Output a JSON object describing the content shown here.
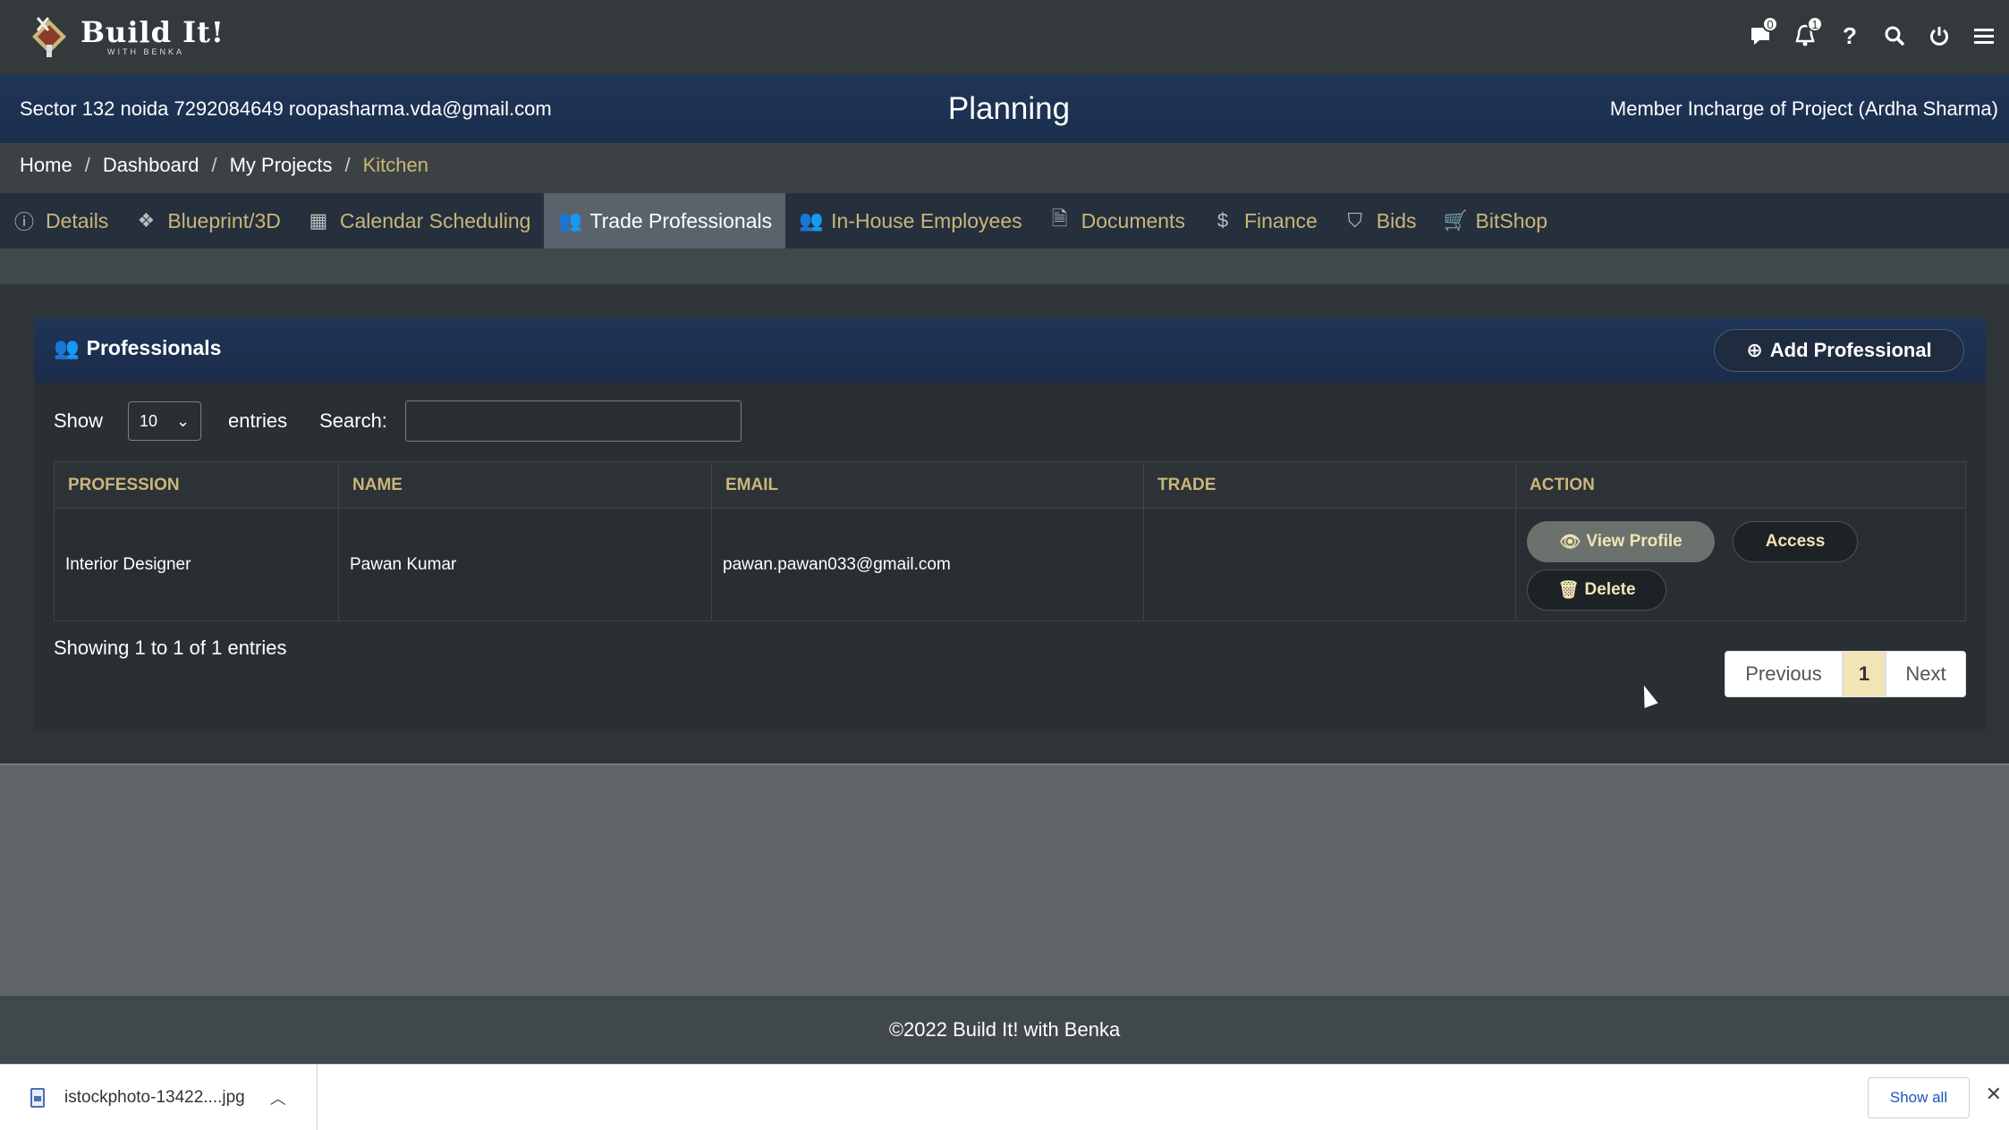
{
  "app": {
    "logo_title": "Build It!",
    "logo_sub": "WITH BENKA"
  },
  "topnav": {
    "messages_count": "0",
    "notifications_count": "1"
  },
  "project": {
    "address_info": "Sector 132 noida 7292084649 roopasharma.vda@gmail.com",
    "stage": "Planning",
    "member": "Member Incharge of Project (Ardha Sharma)"
  },
  "breadcrumb": {
    "items": [
      "Home",
      "Dashboard",
      "My Projects",
      "Kitchen"
    ]
  },
  "tabs": [
    {
      "label": "Details",
      "icon": "info-icon"
    },
    {
      "label": "Blueprint/3D",
      "icon": "cubes-icon"
    },
    {
      "label": "Calendar Scheduling",
      "icon": "calendar-icon"
    },
    {
      "label": "Trade Professionals",
      "icon": "users-icon",
      "active": true
    },
    {
      "label": "In-House Employees",
      "icon": "users-icon"
    },
    {
      "label": "Documents",
      "icon": "document-icon"
    },
    {
      "label": "Finance",
      "icon": "dollar-icon"
    },
    {
      "label": "Bids",
      "icon": "shield-icon"
    },
    {
      "label": "BitShop",
      "icon": "cart-icon"
    }
  ],
  "panel": {
    "title": "Professionals",
    "add_label": "Add Professional",
    "show_label": "Show",
    "entries_value": "10",
    "entries_label": "entries",
    "search_label": "Search:",
    "search_value": ""
  },
  "table": {
    "headers": [
      "PROFESSION",
      "NAME",
      "EMAIL",
      "TRADE",
      "ACTION"
    ],
    "rows": [
      {
        "profession": "Interior Designer",
        "name": "Pawan Kumar",
        "email": "pawan.pawan033@gmail.com",
        "trade": ""
      }
    ],
    "actions": {
      "view_profile": "View Profile",
      "access": "Access",
      "delete": "Delete"
    }
  },
  "pagination": {
    "summary": "Showing 1 to 1 of 1 entries",
    "previous": "Previous",
    "current": "1",
    "next": "Next"
  },
  "footer": {
    "copyright": "©2022 Build It! with Benka"
  },
  "downloads": {
    "file_name": "istockphoto-13422....jpg",
    "show_all": "Show all"
  },
  "colors": {
    "accent_gold": "#c9b67a",
    "header_blue": "#1f3558",
    "tab_active": "#5a636b"
  }
}
